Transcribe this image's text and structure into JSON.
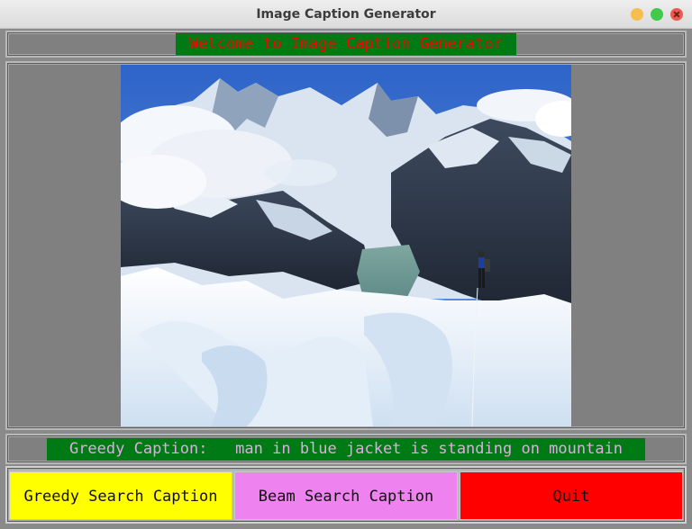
{
  "window": {
    "title": "Image Caption Generator",
    "controls": [
      "minimize",
      "maximize",
      "close"
    ]
  },
  "header": {
    "welcome_text": "Welcome to Image Caption Generator"
  },
  "caption": {
    "text": "Greedy Caption:   man in blue jacket is standing on mountain"
  },
  "buttons": {
    "greedy_label": "Greedy Search Caption",
    "beam_label": "Beam Search Caption",
    "quit_label": "Quit"
  },
  "colors": {
    "label_bg": "#007a14",
    "welcome_fg": "#ff0000",
    "caption_fg": "#e6a7e6",
    "greedy_bg": "#ffff00",
    "beam_bg": "#ee82ee",
    "quit_bg": "#ff0000"
  }
}
